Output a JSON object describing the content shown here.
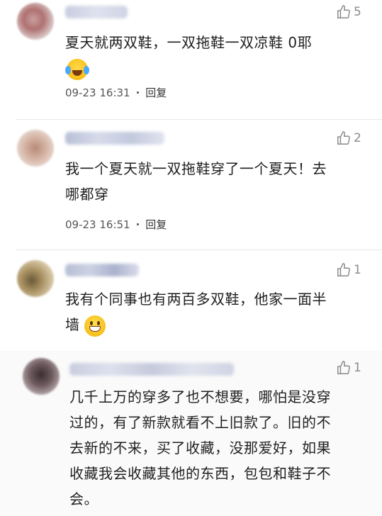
{
  "comments": [
    {
      "text_lines": [
        "夏天就两双鞋，一双拖鞋一双凉鞋 0耶"
      ],
      "has_emoji_second_line": true,
      "emoji": "laughing-crying-emoji",
      "likes": "5",
      "time": "09-23 16:31",
      "reply_label": "回复"
    },
    {
      "text_lines": [
        "我一个夏天就一双拖鞋穿了一个夏天！去",
        "哪都穿"
      ],
      "likes": "2",
      "time": "09-23 16:51",
      "reply_label": "回复"
    },
    {
      "text_lines": [
        "我有个同事也有两百多双鞋，他家一面半",
        "墙"
      ],
      "emoji": "grinning-emoji",
      "likes": "1"
    }
  ],
  "reply": {
    "text_lines": [
      "几千上万的穿多了也不想要，哪怕是没穿",
      "过的，有了新款就看不上旧款了。旧的不",
      "去新的不来，买了收藏，没那爱好，如果",
      "收藏我会收藏其他的东西，包包和鞋子不",
      "会。"
    ],
    "likes": "1"
  },
  "icons": {
    "like": "thumbs-up-icon"
  },
  "colors": {
    "text": "#1f1f1f",
    "meta": "#555555",
    "like": "#8a8a8a"
  }
}
